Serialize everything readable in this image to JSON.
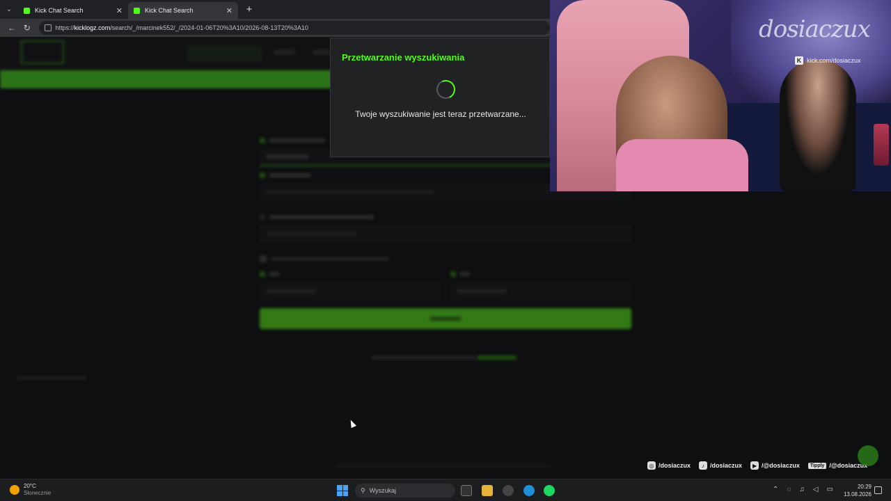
{
  "browser": {
    "tabs": [
      {
        "title": "Kick Chat Search",
        "active": false
      },
      {
        "title": "Kick Chat Search",
        "active": true
      }
    ],
    "url_prefix": "https://",
    "url_domain": "kicklogz.com",
    "url_path": "/search/_/marcinek552/_/2024-01-06T20%3A10/2026-08-13T20%3A10"
  },
  "modal": {
    "title": "Przetwarzanie wyszukiwania",
    "message": "Twoje wyszukiwanie jest teraz przetwarzane..."
  },
  "stream_overlay": {
    "brand": "dosiaczux",
    "kick_link": "kick.com/dosiaczux",
    "socials": [
      {
        "icon": "instagram-icon",
        "handle": "/dosiaczux"
      },
      {
        "icon": "tiktok-icon",
        "handle": "/dosiaczux"
      },
      {
        "icon": "youtube-icon",
        "handle": "/@dosiaczux"
      },
      {
        "icon": "tipply-icon",
        "badge": "Tipply",
        "handle": "/@dosiaczux"
      }
    ]
  },
  "taskbar": {
    "weather_temp": "20°C",
    "weather_desc": "Słonecznie",
    "search_placeholder": "Wyszukaj",
    "time": "20:29",
    "date": "13.08.2026"
  },
  "colors": {
    "accent": "#53fc18",
    "modal_bg": "#202224",
    "page_bg": "#0e0f10"
  }
}
